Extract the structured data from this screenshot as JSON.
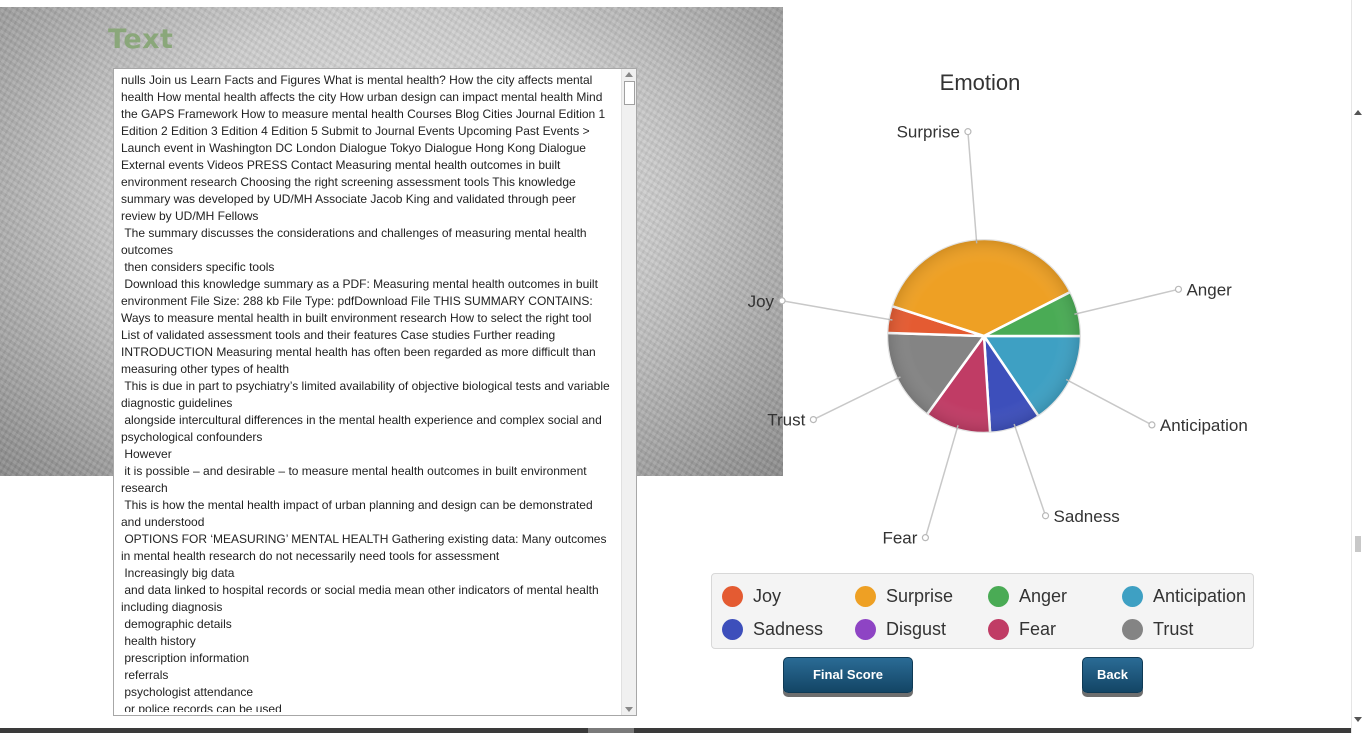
{
  "section_title": "Text",
  "text_content": "nulls Join us Learn Facts and Figures What is mental health? How the city affects mental health How mental health affects the city How urban design can impact mental health Mind the GAPS Framework How to measure mental health Courses Blog Cities Journal Edition 1 Edition 2 Edition 3 Edition 4 Edition 5 Submit to Journal Events Upcoming Past Events > Launch event in Washington DC London Dialogue Tokyo Dialogue Hong Kong Dialogue External events Videos PRESS Contact Measuring mental health outcomes in built environment research Choosing the right screening assessment tools This knowledge summary was developed by UD/MH Associate Jacob King and validated through peer review by UD/MH Fellows\n The summary discusses the considerations and challenges of measuring mental health outcomes\n then considers specific tools\n Download this knowledge summary as a PDF: Measuring mental health outcomes in built environment File Size: 288 kb File Type: pdfDownload File THIS SUMMARY CONTAINS: Ways to measure mental health in built environment research How to select the right tool List of validated assessment tools and their features Case studies Further reading INTRODUCTION Measuring mental health has often been regarded as more difficult than measuring other types of health\n This is due in part to psychiatry’s limited availability of objective biological tests and variable diagnostic guidelines\n alongside intercultural differences in the mental health experience and complex social and psychological confounders\n However\n it is possible – and desirable – to measure mental health outcomes in built environment research\n This is how the mental health impact of urban planning and design can be demonstrated and understood\n OPTIONS FOR ‘MEASURING’ MENTAL HEALTH Gathering existing data: Many outcomes in mental health research do not necessarily need tools for assessment\n Increasingly big data\n and data linked to hospital records or social media mean other indicators of mental health including diagnosis\n demographic details\n health history\n prescription information\n referrals\n psychologist attendance\n or police records can be used",
  "chart_data": {
    "type": "pie",
    "title": "Emotion",
    "start_angle_deg": 0,
    "slices": [
      {
        "name": "Anticipation",
        "value": 15.5,
        "color": "#3ea0c3"
      },
      {
        "name": "Sadness",
        "value": 8.5,
        "color": "#3d4fbb"
      },
      {
        "name": "Disgust",
        "value": 0,
        "color": "#8e44c4"
      },
      {
        "name": "Fear",
        "value": 11,
        "color": "#c03c65"
      },
      {
        "name": "Trust",
        "value": 15.5,
        "color": "#848484"
      },
      {
        "name": "Joy",
        "value": 4.5,
        "color": "#e45b32"
      },
      {
        "name": "Surprise",
        "value": 37.5,
        "color": "#eea024"
      },
      {
        "name": "Anger",
        "value": 7.5,
        "color": "#4aab55"
      }
    ],
    "legend": {
      "placement": "bottom",
      "items": [
        {
          "label": "Joy",
          "color": "#e45b32"
        },
        {
          "label": "Surprise",
          "color": "#eea024"
        },
        {
          "label": "Anger",
          "color": "#4aab55"
        },
        {
          "label": "Anticipation",
          "color": "#3ea0c3"
        },
        {
          "label": "Sadness",
          "color": "#3d4fbb"
        },
        {
          "label": "Disgust",
          "color": "#8e44c4"
        },
        {
          "label": "Fear",
          "color": "#c03c65"
        },
        {
          "label": "Trust",
          "color": "#848484"
        }
      ]
    }
  },
  "buttons": {
    "final_score": "Final Score",
    "back": "Back"
  }
}
